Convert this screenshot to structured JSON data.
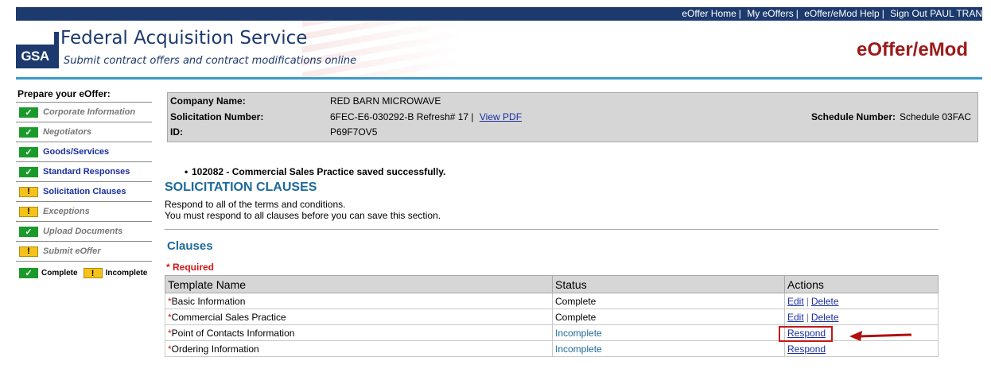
{
  "topnav": {
    "home": "eOffer Home",
    "my_eoffers": "My eOffers",
    "help": "eOffer/eMod Help",
    "signout": "Sign Out PAUL TRAN"
  },
  "header": {
    "logo": "GSA",
    "title": "Federal Acquisition Service",
    "subtitle": "Submit contract offers and contract modifications online",
    "app_title": "eOffer/eMod"
  },
  "sidebar": {
    "title": "Prepare your eOffer:",
    "items": [
      {
        "label": "Corporate Information",
        "status": "complete",
        "style": "done"
      },
      {
        "label": "Negotiators",
        "status": "complete",
        "style": "done"
      },
      {
        "label": "Goods/Services",
        "status": "complete",
        "style": "link"
      },
      {
        "label": "Standard Responses",
        "status": "complete",
        "style": "link"
      },
      {
        "label": "Solicitation Clauses",
        "status": "incomplete",
        "style": "link"
      },
      {
        "label": "Exceptions",
        "status": "incomplete",
        "style": "done"
      },
      {
        "label": "Upload Documents",
        "status": "complete",
        "style": "done"
      },
      {
        "label": "Submit eOffer",
        "status": "incomplete",
        "style": "done"
      }
    ],
    "legend": {
      "complete": "Complete",
      "incomplete": "Incomplete"
    },
    "check_glyph": "✓",
    "warn_glyph": "!"
  },
  "company": {
    "name_label": "Company Name:",
    "name_value": "RED BARN MICROWAVE",
    "solicitation_label": "Solicitation Number:",
    "solicitation_value": "6FEC-E6-030292-B Refresh# 17 |",
    "view_pdf": "View PDF",
    "id_label": "ID:",
    "id_value": "P69F7OV5",
    "schedule_label": "Schedule Number:",
    "schedule_value": "Schedule 03FAC"
  },
  "message": {
    "code": "102082",
    "text": " - Commercial Sales Practice saved successfully."
  },
  "section": {
    "title": "SOLICITATION CLAUSES",
    "line1": "Respond to all of the terms and conditions.",
    "line2": "You must respond to all clauses before you can save this section."
  },
  "clauses": {
    "title": "Clauses",
    "required": "* Required",
    "headers": [
      "Template Name",
      "Status",
      "Actions"
    ],
    "rows": [
      {
        "name": "Basic Information",
        "status": "Complete",
        "actions": [
          "Edit",
          "Delete"
        ]
      },
      {
        "name": "Commercial Sales Practice",
        "status": "Complete",
        "actions": [
          "Edit",
          "Delete"
        ]
      },
      {
        "name": "Point of Contacts Information",
        "status": "Incomplete",
        "actions": [
          "Respond"
        ]
      },
      {
        "name": "Ordering Information",
        "status": "Incomplete",
        "actions": [
          "Respond"
        ]
      }
    ]
  },
  "colors": {
    "nav_bg": "#1d3a6e",
    "app_title": "#9b1b1b",
    "accent_blue": "#1e6a9a",
    "required_red": "#d01818",
    "complete_green": "#1a9a2a",
    "incomplete_yellow": "#f5c21b"
  }
}
